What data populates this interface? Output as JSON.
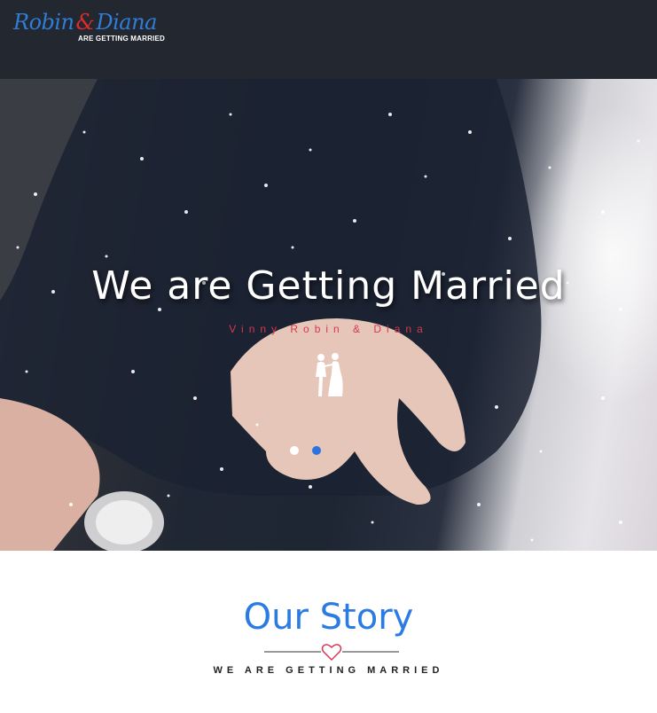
{
  "header": {
    "logo": {
      "name1": "Robin",
      "ampersand": "&",
      "name2": "Diana",
      "subtitle": "ARE GETTING MARRIED"
    }
  },
  "hero": {
    "title": "We are Getting Married",
    "subtitle": "Vinny Robin & Diana",
    "icon": "couple-silhouette-icon",
    "carousel": {
      "slides": 2,
      "active_slide": 2
    }
  },
  "story": {
    "title": "Our Story",
    "divider_icon": "heart-outline-icon",
    "tagline": "WE ARE GETTING MARRIED"
  },
  "colors": {
    "header_bg": "#222730",
    "accent_blue": "#2b7be4",
    "accent_red": "#d8384e"
  }
}
